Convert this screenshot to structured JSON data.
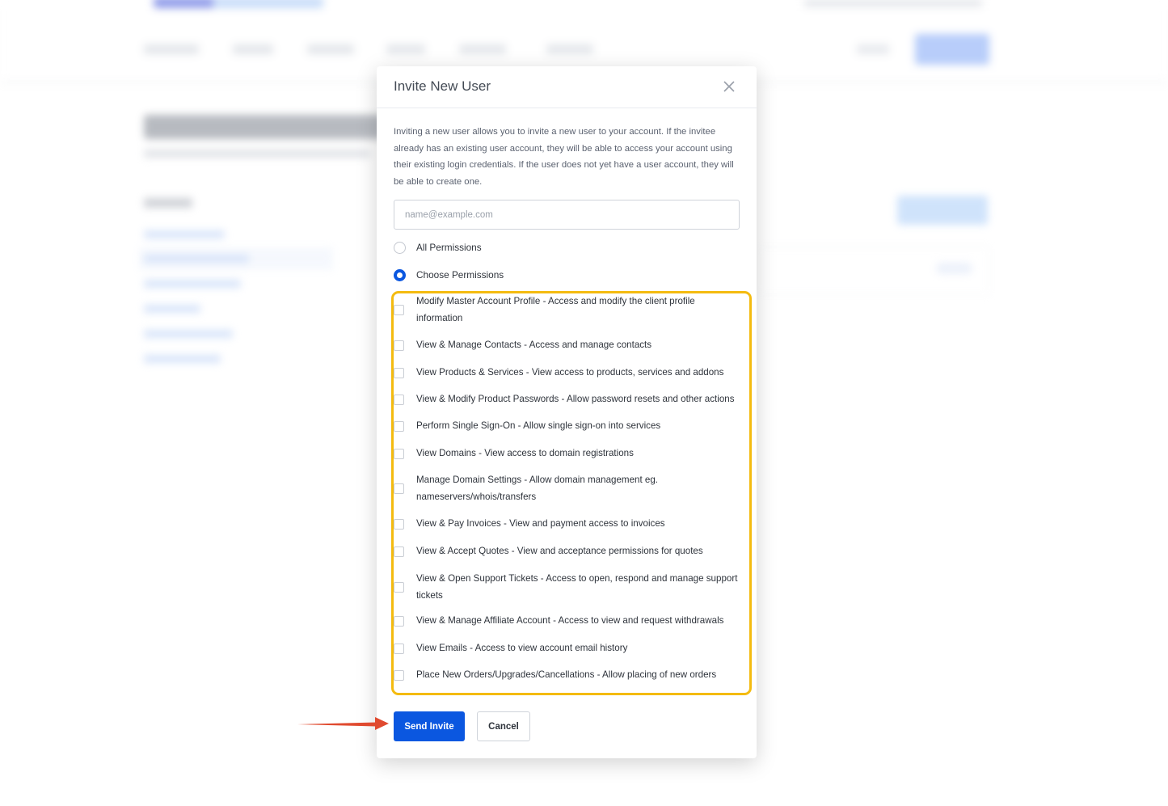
{
  "modal": {
    "title": "Invite New User",
    "description": "Inviting a new user allows you to invite a new user to your account. If the invitee already has an existing user account, they will be able to access your account using their existing login credentials. If the user does not yet have a user account, they will be able to create one.",
    "email": {
      "value": "",
      "placeholder": "name@example.com"
    },
    "permission_modes": [
      {
        "label": "All Permissions",
        "selected": false
      },
      {
        "label": "Choose Permissions",
        "selected": true
      }
    ],
    "permissions": [
      {
        "label": "Modify Master Account Profile - Access and modify the client profile information",
        "checked": false
      },
      {
        "label": "View & Manage Contacts - Access and manage contacts",
        "checked": false
      },
      {
        "label": "View Products & Services - View access to products, services and addons",
        "checked": false
      },
      {
        "label": "View & Modify Product Passwords - Allow password resets and other actions",
        "checked": false
      },
      {
        "label": "Perform Single Sign-On - Allow single sign-on into services",
        "checked": false
      },
      {
        "label": "View Domains - View access to domain registrations",
        "checked": false
      },
      {
        "label": "Manage Domain Settings - Allow domain management eg. nameservers/whois/transfers",
        "checked": false
      },
      {
        "label": "View & Pay Invoices - View and payment access to invoices",
        "checked": false
      },
      {
        "label": "View & Accept Quotes - View and acceptance permissions for quotes",
        "checked": false
      },
      {
        "label": "View & Open Support Tickets - Access to open, respond and manage support tickets",
        "checked": false
      },
      {
        "label": "View & Manage Affiliate Account - Access to view and request withdrawals",
        "checked": false
      },
      {
        "label": "View Emails - Access to view account email history",
        "checked": false
      },
      {
        "label": "Place New Orders/Upgrades/Cancellations - Allow placing of new orders",
        "checked": false
      }
    ],
    "send_label": "Send Invite",
    "cancel_label": "Cancel"
  },
  "colors": {
    "primary": "#0b57e0",
    "highlight_box": "#f4bb10",
    "annotation_arrow": "#e04a2f"
  },
  "icons": {
    "close": "close-icon",
    "arrow": "annotation-arrow-icon"
  }
}
